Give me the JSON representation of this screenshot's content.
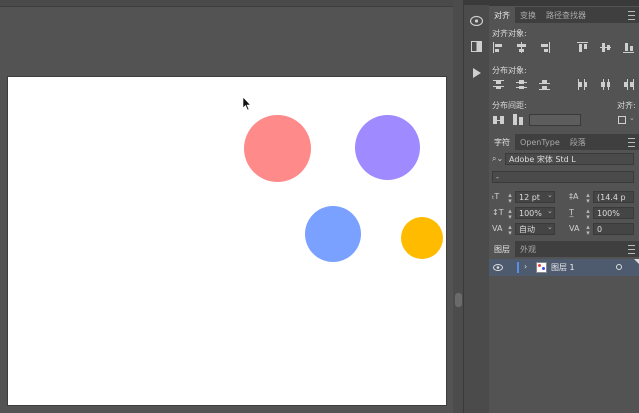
{
  "canvas": {
    "circles": [
      {
        "color": "#ff8a8a"
      },
      {
        "color": "#a08aff"
      },
      {
        "color": "#7aa1ff"
      },
      {
        "color": "#ffbb00"
      }
    ]
  },
  "iconstrip": {
    "icons": [
      "libraries-icon",
      "swatch-icon",
      "play-icon"
    ]
  },
  "align_panel": {
    "tabs": [
      "对齐",
      "变换",
      "路径查找器"
    ],
    "align_objects_label": "对齐对象:",
    "distribute_objects_label": "分布对象:",
    "distribute_spacing_label": "分布间距:",
    "align_to_label": "对齐:"
  },
  "character_panel": {
    "tabs": [
      "字符",
      "OpenType",
      "段落"
    ],
    "font_family": "Adobe 宋体 Std L",
    "font_style": "-",
    "font_size": "12 pt",
    "leading": "(14.4 p",
    "vertical_scale": "100%",
    "horizontal_scale": "100%",
    "kerning": "自动",
    "tracking": "0"
  },
  "layers_panel": {
    "tabs": [
      "图层",
      "外观"
    ],
    "layers": [
      {
        "name": "图层 1"
      }
    ]
  }
}
